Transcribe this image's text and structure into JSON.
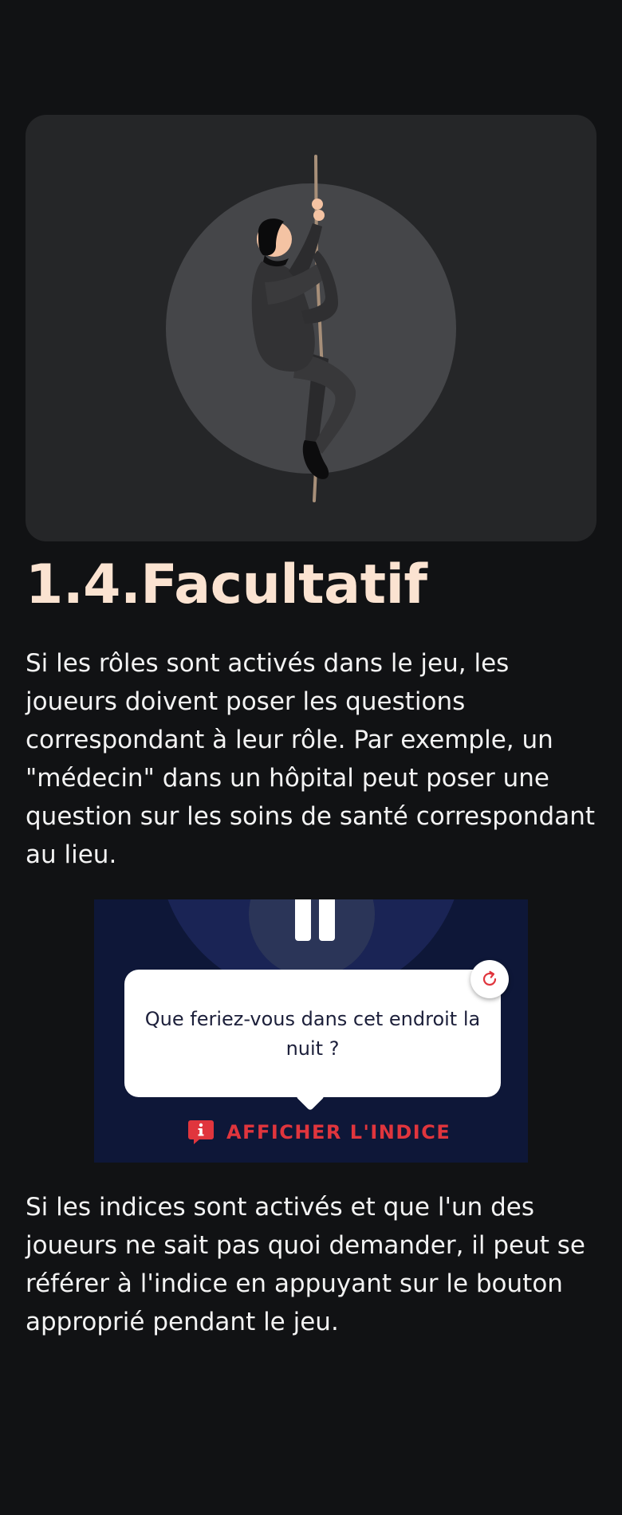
{
  "section": {
    "title": "1.4.Facultatif",
    "paragraph1": "Si les rôles sont activés dans le jeu, les joueurs doivent poser les questions correspondant à leur rôle. Par exemple, un \"médecin\" dans un hôpital peut poser une question sur les soins de santé correspondant au lieu.",
    "paragraph2": "Si les indices sont activés et que l'un des joueurs ne sait pas quoi demander, il peut se référer à l'indice en appuyant sur le bouton approprié pendant le jeu."
  },
  "hint_demo": {
    "question": "Que feriez-vous dans cet endroit la nuit ?",
    "hint_button_label": "AFFICHER L'INDICE",
    "icons": {
      "pause": "pause-icon",
      "refresh": "refresh-icon",
      "hint": "info-speech-bubble-icon"
    }
  },
  "illustration": {
    "subject": "climbing-man-illustration"
  },
  "colors": {
    "background": "#111214",
    "title": "#fbe3d1",
    "card": "#252628",
    "hint_panel": "#0e1738",
    "accent_red": "#e0353d"
  }
}
